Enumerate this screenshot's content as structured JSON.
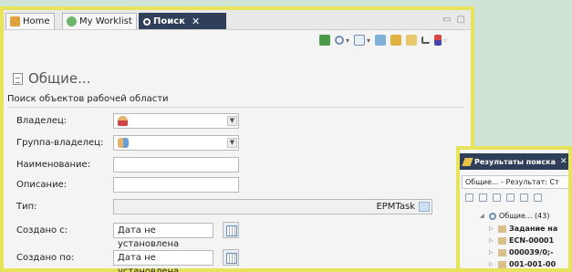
{
  "tabs": [
    {
      "label": "Home",
      "icon": "home-icon"
    },
    {
      "label": "My Worklist",
      "icon": "worklist-icon"
    },
    {
      "label": "Поиск",
      "icon": "search-icon",
      "active": true
    }
  ],
  "close_glyph": "✕",
  "panel": {
    "title": "Общие...",
    "subtitle": "Поиск объектов рабочей области"
  },
  "form": {
    "owner_label": "Владелец:",
    "group_label": "Группа-владелец:",
    "name_label": "Наименование:",
    "description_label": "Описание:",
    "type_label": "Тип:",
    "type_value": "EPMTask",
    "created_after_label": "Создано с:",
    "created_after_value": "Дата не установлена",
    "created_before_label": "Создано по:",
    "created_before_value": "Дата не установлена"
  },
  "results": {
    "tab_label": "Результаты поиска",
    "header": "Общие... - Результат: Ст",
    "tree": [
      {
        "label": "Общие... (43)",
        "bold": false
      },
      {
        "label": "Задание на",
        "bold": true
      },
      {
        "label": "ECN-00001",
        "bold": true
      },
      {
        "label": "000039/0;-",
        "bold": true
      },
      {
        "label": "001-001-00",
        "bold": true
      }
    ]
  },
  "colors": {
    "panel_border": "#e7e35a",
    "active_tab": "#2f3f59",
    "background": "#cfe4d4"
  }
}
